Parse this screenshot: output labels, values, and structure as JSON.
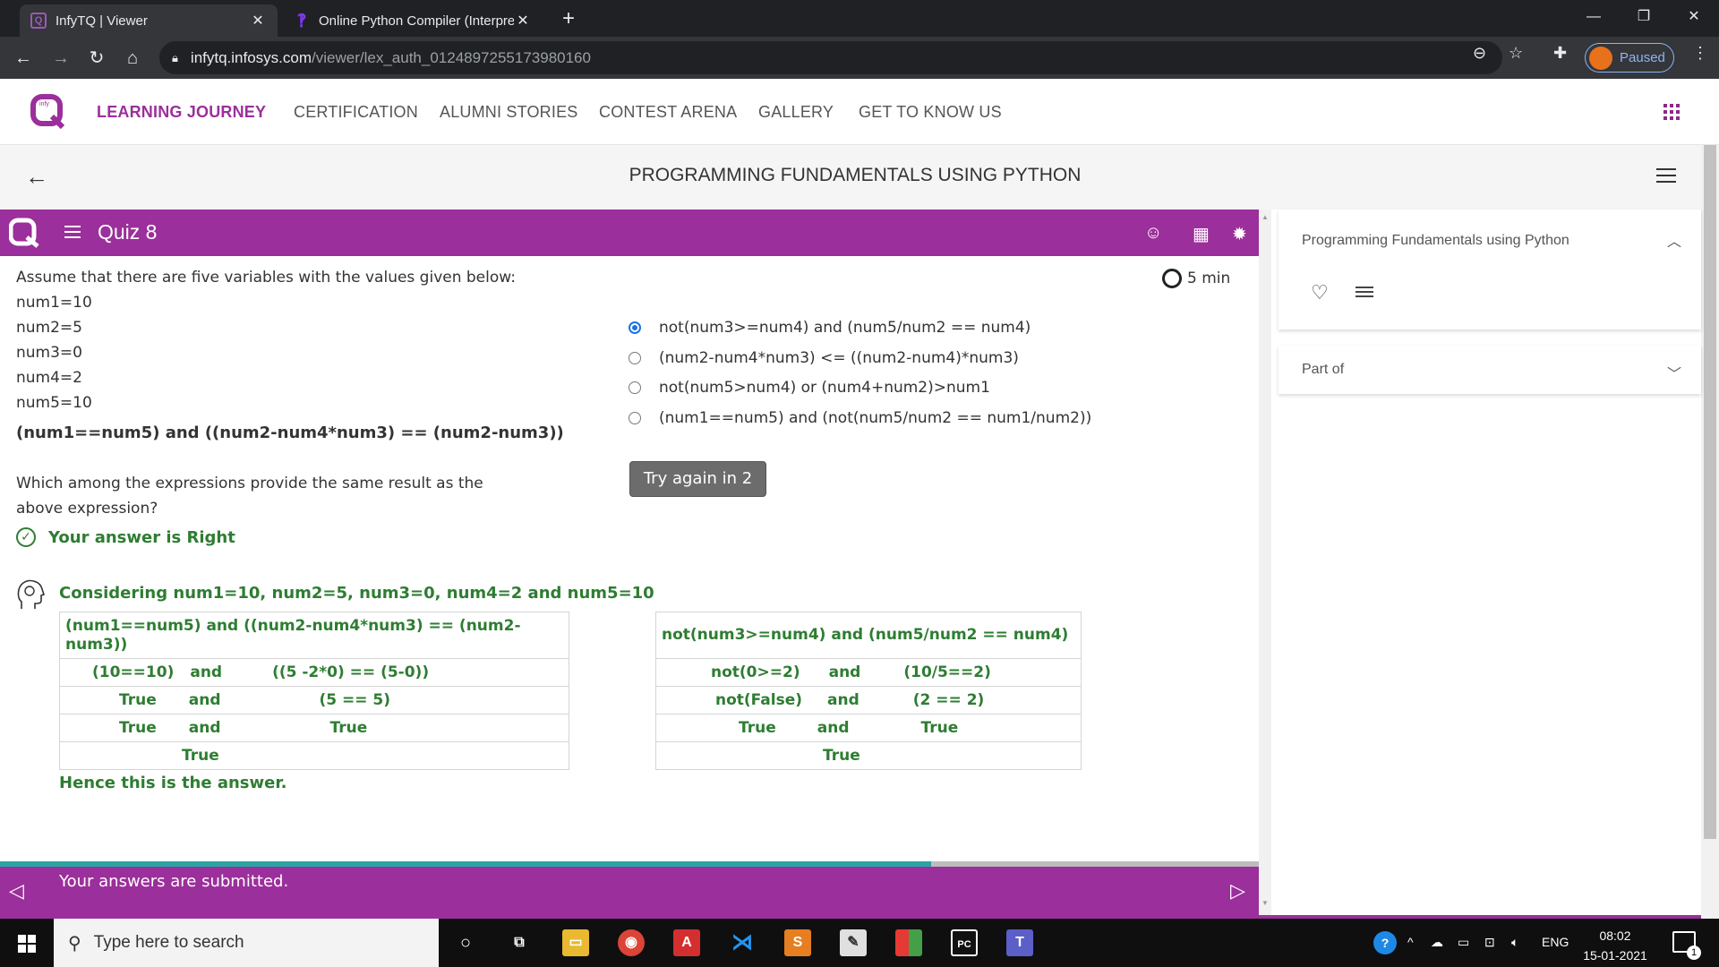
{
  "browser": {
    "tabs": [
      {
        "title": "InfyTQ | Viewer"
      },
      {
        "title": "Online Python Compiler (Interpre"
      }
    ],
    "url_host": "infytq.infosys.com",
    "url_path": "/viewer/lex_auth_0124897255173980160",
    "profile_label": "Paused"
  },
  "site_nav": {
    "items": [
      "LEARNING JOURNEY",
      "CERTIFICATION",
      "ALUMNI STORIES",
      "CONTEST ARENA",
      "GALLERY",
      "GET TO KNOW US"
    ]
  },
  "course": {
    "title": "PROGRAMMING FUNDAMENTALS USING PYTHON"
  },
  "quiz": {
    "title": "Quiz 8",
    "timer": "5 min",
    "question_intro": "Assume that there are five variables with the values given below:",
    "variables": [
      "num1=10",
      "num2=5",
      "num3=0",
      "num4=2",
      "num5=10"
    ],
    "expression": "(num1==num5) and ((num2-num4*num3) == (num2-num3))",
    "question_line1": "Which among the expressions provide the same result as the",
    "question_line2": "above expression?",
    "options": [
      {
        "label": "not(num3>=num4) and (num5/num2 == num4)",
        "selected": true
      },
      {
        "label": "(num2-num4*num3) <= ((num2-num4)*num3)",
        "selected": false
      },
      {
        "label": "not(num5>num4) or (num4+num2)>num1",
        "selected": false
      },
      {
        "label": "(num1==num5) and (not(num5/num2 == num1/num2))",
        "selected": false
      }
    ],
    "try_again_label": "Try again in 2",
    "result_text": "Your answer is Right",
    "explanation_heading": "Considering num1=10, num2=5, num3=0, num4=2 and num5=10",
    "table_left": {
      "header": "(num1==num5) and ((num2-num4*num3) == (num2-num3))",
      "rows": [
        [
          "(10==10)",
          "and",
          "((5 -2*0) == (5-0))"
        ],
        [
          "True",
          "and",
          "(5 == 5)"
        ],
        [
          "True",
          "and",
          "True"
        ],
        [
          "True"
        ]
      ]
    },
    "table_right": {
      "header": "not(num3>=num4) and (num5/num2 == num4)",
      "rows": [
        [
          "not(0>=2)",
          "and",
          "(10/5==2)"
        ],
        [
          "not(False)",
          "and",
          "(2 == 2)"
        ],
        [
          "True",
          "and",
          "True"
        ],
        [
          "True"
        ]
      ]
    },
    "conclusion": "Hence this is the answer.",
    "progress_fraction": 0.74,
    "footer_message": "Your answers are submitted."
  },
  "side_panel": {
    "course_card_title": "Programming Fundamentals using Python",
    "part_of_label": "Part of"
  },
  "taskbar": {
    "search_placeholder": "Type here to search",
    "language": "ENG",
    "time": "08:02",
    "date": "15-01-2021",
    "notification_count": "1"
  },
  "colors": {
    "brand_purple": "#9b2f9b",
    "answer_green": "#2e7d32",
    "progress_teal": "#2aa4a4"
  }
}
